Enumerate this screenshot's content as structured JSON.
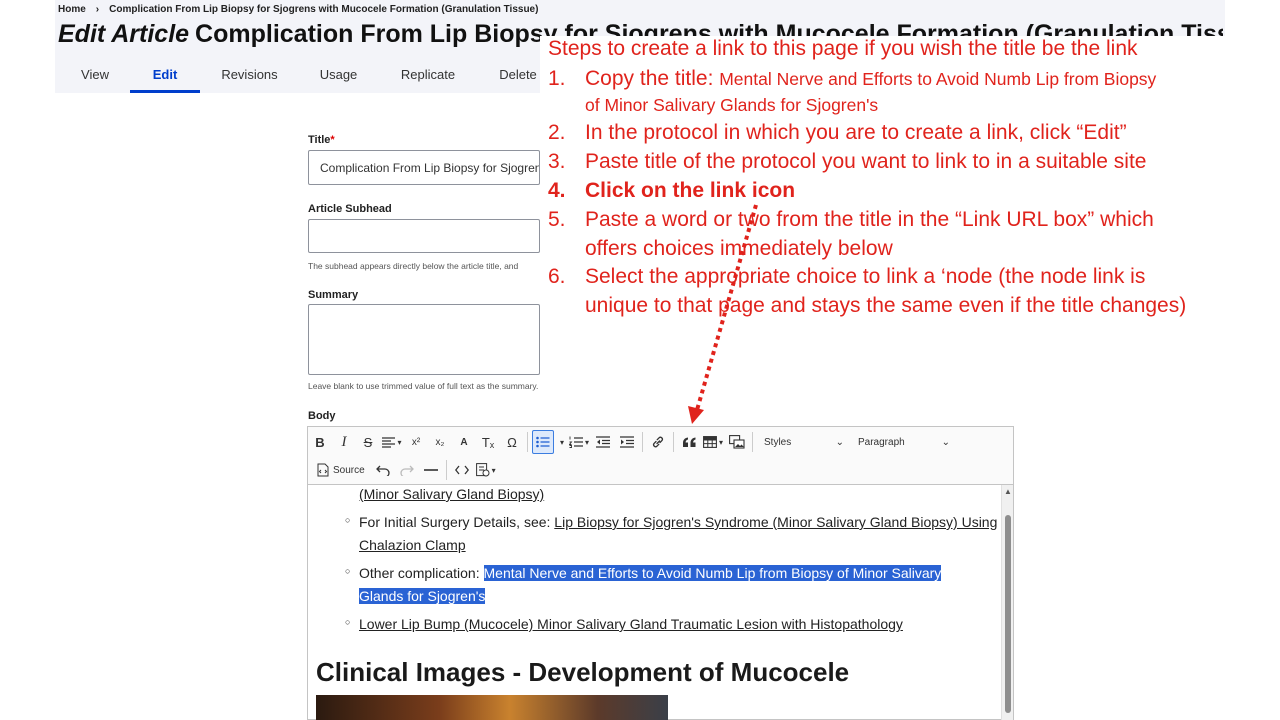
{
  "breadcrumb": {
    "home": "Home",
    "separator": "›",
    "current": "Complication From Lip Biopsy for Sjogrens with Mucocele Formation (Granulation Tissue)"
  },
  "page_title": {
    "prefix": "Edit Article",
    "title": "Complication From Lip Biopsy for Sjogrens with Mucocele Formation (Granulation Tissue)"
  },
  "tabs": [
    {
      "label": "View"
    },
    {
      "label": "Edit"
    },
    {
      "label": "Revisions"
    },
    {
      "label": "Usage"
    },
    {
      "label": "Replicate"
    },
    {
      "label": "Delete"
    }
  ],
  "form": {
    "title_label": "Title",
    "required_mark": "*",
    "title_value": "Complication From Lip Biopsy for Sjogrens",
    "subhead_label": "Article Subhead",
    "subhead_help": "The subhead appears directly below the article title, and",
    "summary_label": "Summary",
    "summary_help": "Leave blank to use trimmed value of full text as the summary.",
    "body_label": "Body"
  },
  "toolbar": {
    "bold": "B",
    "italic": "I",
    "strike": "S",
    "superscript": "x²",
    "subscript": "x₂",
    "font_color": "A",
    "clear_format": "Tₓ",
    "special_chars": "Ω",
    "styles": "Styles",
    "paragraph": "Paragraph",
    "source": "Source"
  },
  "editor": {
    "items": [
      {
        "link": "(Minor Salivary Gland Biopsy)"
      },
      {
        "prefix": "For Initial Surgery Details, see: ",
        "link_line1": "Lip Biopsy for Sjogren's Syndrome (Minor Salivary Gland Biopsy) Using",
        "link_line2": "Chalazion Clamp"
      },
      {
        "prefix": "Other complication: ",
        "highlight_line1": "Mental Nerve and Efforts to Avoid Numb Lip from Biopsy of Minor Salivary",
        "highlight_line2": "Glands for Sjogren's"
      },
      {
        "link": "Lower Lip Bump (Mucocele) Minor Salivary Gland Traumatic Lesion with Histopathology"
      }
    ],
    "heading": "Clinical Images - Development of Mucocele"
  },
  "annotation": {
    "heading": "Steps to create a link to this page if you wish the title be the link",
    "steps": [
      {
        "num": "1.",
        "text": "Copy the title: ",
        "quoted_line1": "Mental Nerve and Efforts to Avoid Numb Lip from Biopsy",
        "quoted_line2": "of Minor Salivary Glands for Sjogren's"
      },
      {
        "num": "2.",
        "text": "In the protocol in which you are to create a link, click “Edit”"
      },
      {
        "num": "3.",
        "text": "Paste title of the protocol you want to link to in a suitable site"
      },
      {
        "num": "4.",
        "text": "Click on the link icon"
      },
      {
        "num": "5.",
        "text": "Paste a word or two from the title in the “Link URL box” which",
        "cont": "offers choices immediately below"
      },
      {
        "num": "6.",
        "text": "Select the appropriate choice to link a ‘node (the node link is",
        "cont": "unique to that page and stays the same even if the title changes)"
      }
    ],
    "color": "#e0231c"
  }
}
